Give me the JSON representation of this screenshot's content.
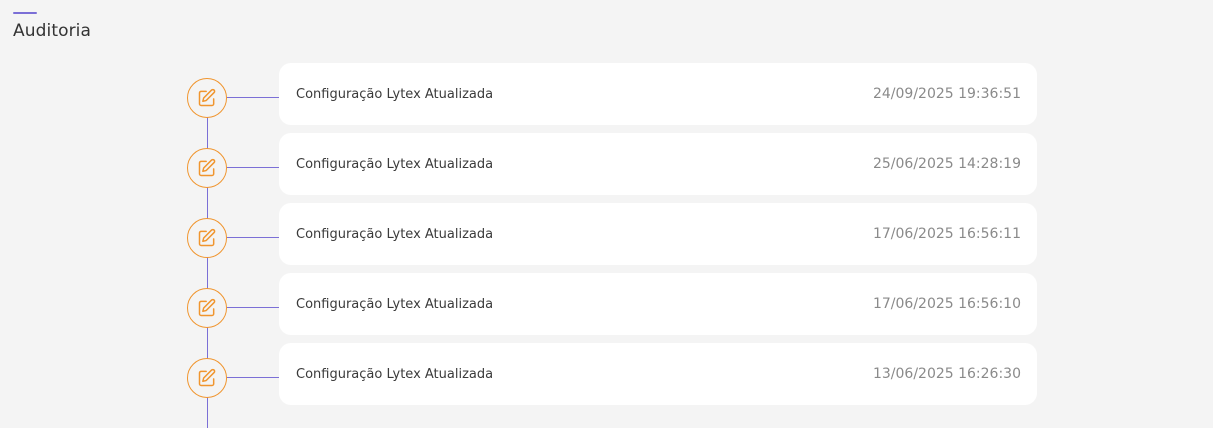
{
  "page": {
    "title": "Auditoria"
  },
  "colors": {
    "accent": "#7b6fd6",
    "icon": "#f0952e",
    "background": "#f4f4f4",
    "card": "#ffffff"
  },
  "timeline": {
    "entries": [
      {
        "label": "Configuração Lytex Atualizada",
        "timestamp": "24/09/2025 19:36:51",
        "icon": "edit-icon"
      },
      {
        "label": "Configuração Lytex Atualizada",
        "timestamp": "25/06/2025 14:28:19",
        "icon": "edit-icon"
      },
      {
        "label": "Configuração Lytex Atualizada",
        "timestamp": "17/06/2025 16:56:11",
        "icon": "edit-icon"
      },
      {
        "label": "Configuração Lytex Atualizada",
        "timestamp": "17/06/2025 16:56:10",
        "icon": "edit-icon"
      },
      {
        "label": "Configuração Lytex Atualizada",
        "timestamp": "13/06/2025 16:26:30",
        "icon": "edit-icon"
      }
    ]
  }
}
